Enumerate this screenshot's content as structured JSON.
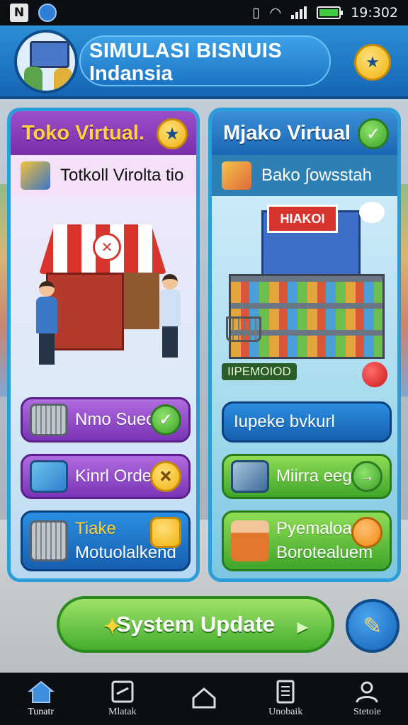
{
  "status_bar": {
    "time": "19:302",
    "icons": [
      "n-icon",
      "globe-icon",
      "vibrate-icon",
      "wifi-icon",
      "signal-icon",
      "battery-icon"
    ]
  },
  "header": {
    "title_line1": "SIMULASI BISNUIS",
    "title_line2": "Indansia"
  },
  "left_panel": {
    "title": "Toko Virtual.",
    "subtitle": "Totkoll Virolta tio",
    "buttons": [
      {
        "label": "Nmo Sueo"
      },
      {
        "label": "Kinrl Orden"
      },
      {
        "label_line1": "Tiake",
        "label_line2": "Motuolalkend"
      }
    ]
  },
  "right_panel": {
    "title": "Mjako Virtual",
    "subtitle": "Bako ∫owsstah",
    "store_sign": "HIAKOI",
    "tag": "IIPEMOIOD",
    "buttons": [
      {
        "label": "Iupeke bvkurl"
      },
      {
        "label": "Miirra eegs"
      },
      {
        "label_line1": "Pyemaloa",
        "label_line2": "Borotealuem"
      }
    ]
  },
  "update_button": {
    "label": "System Update"
  },
  "nav": {
    "items": [
      {
        "label": "Tunatr"
      },
      {
        "label": "Mlatak"
      },
      {
        "label": ""
      },
      {
        "label": "Unobaik"
      },
      {
        "label": "Stetoie"
      }
    ]
  },
  "colors": {
    "accent": "#2a8ee0",
    "purple": "#7a34b5",
    "green": "#43ad2d",
    "gold": "#f1b20f"
  }
}
